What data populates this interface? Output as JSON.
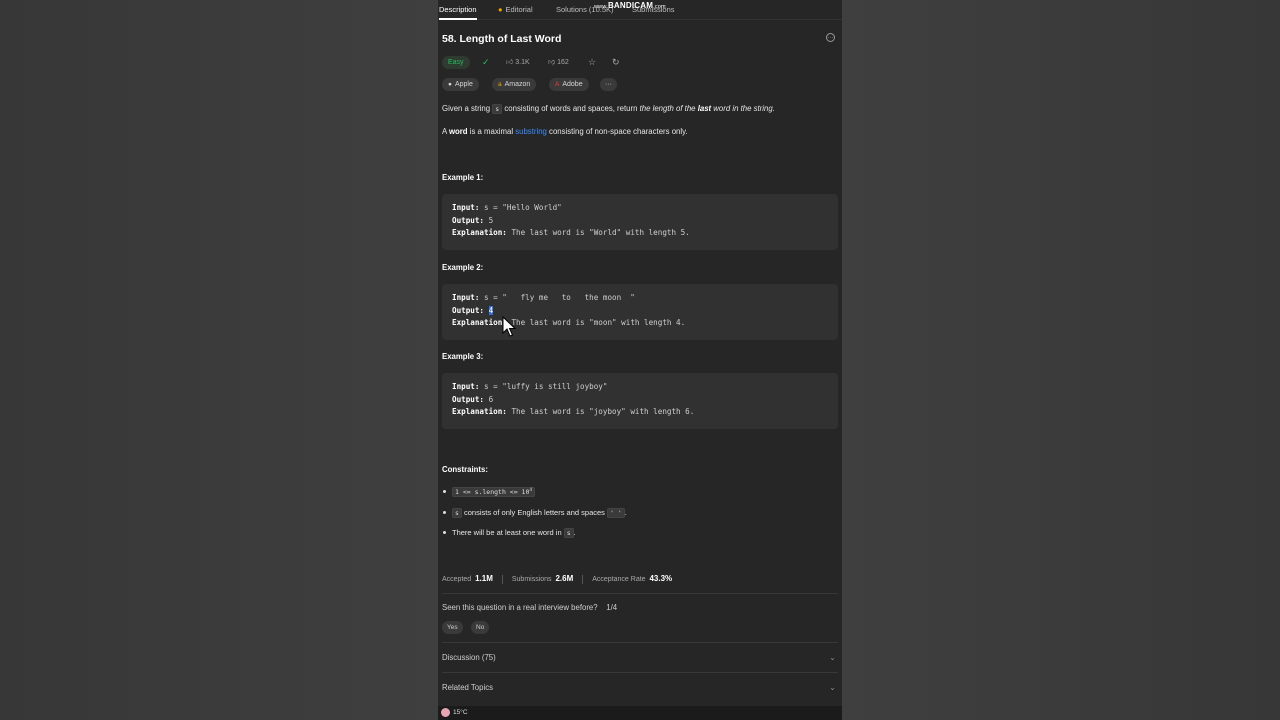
{
  "watermark": {
    "prefix": "www.",
    "brand": "BANDICAM",
    "suffix": ".com"
  },
  "tabs": [
    {
      "label": "Description",
      "active": true
    },
    {
      "label": "Editorial",
      "icon": "editorial-icon"
    },
    {
      "label": "Solutions (10.5K)"
    },
    {
      "label": "Submissions"
    }
  ],
  "problem": {
    "title": "58. Length of Last Word",
    "difficulty": "Easy",
    "likes": "3.1K",
    "dislikes": "162",
    "companies": [
      "Apple",
      "Amazon",
      "Adobe"
    ],
    "more_label": "···",
    "desc1": {
      "a": "Given a string ",
      "code": "s",
      "b": " consisting of words and spaces, return ",
      "c": "the length of the ",
      "d": "last",
      "e": " word in the string."
    },
    "desc2": {
      "a": "A ",
      "word": "word",
      "b": " is a maximal ",
      "link": "substring",
      "c": " consisting of non-space characters only."
    }
  },
  "examples": [
    {
      "heading": "Example 1:",
      "input_label": "Input:",
      "input": " s = \"Hello World\"",
      "output_label": "Output:",
      "output": "5",
      "expl_label": "Explanation:",
      "expl": " The last word is \"World\" with length 5."
    },
    {
      "heading": "Example 2:",
      "input_label": "Input:",
      "input": " s = \"   fly me   to   the moon  \"",
      "output_label": "Output:",
      "output": "4",
      "expl_label": "Explanation:",
      "expl": " The last word is \"moon\" with length 4."
    },
    {
      "heading": "Example 3:",
      "input_label": "Input:",
      "input": " s = \"luffy is still joyboy\"",
      "output_label": "Output:",
      "output": "6",
      "expl_label": "Explanation:",
      "expl": " The last word is \"joyboy\" with length 6."
    }
  ],
  "constraints": {
    "heading": "Constraints:",
    "c1": "1 <= s.length <= 10",
    "c1_sup": "4",
    "c2_code": "s",
    "c2_text": " consists of only English letters and spaces ",
    "c2_code2": "' '",
    "c2_end": ".",
    "c3_text": "There will be at least one word in ",
    "c3_code": "s",
    "c3_end": "."
  },
  "stats": {
    "accepted_label": "Accepted",
    "accepted": "1.1M",
    "submissions_label": "Submissions",
    "submissions": "2.6M",
    "rate_label": "Acceptance Rate",
    "rate": "43.3%"
  },
  "interview": {
    "question": "Seen this question in a real interview before?",
    "count": "1/4",
    "yes": "Yes",
    "no": "No"
  },
  "sections": {
    "discussion": "Discussion (75)",
    "related": "Related Topics"
  },
  "taskbar": {
    "temp": "15°C"
  },
  "colors": {
    "accent_easy": "#2cbb5d",
    "link": "#3b8cff",
    "selection": "#2f6fd6"
  }
}
